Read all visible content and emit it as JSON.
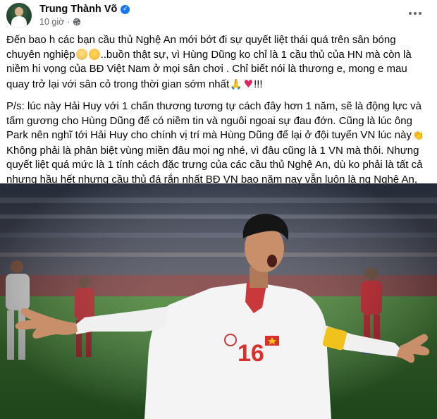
{
  "post": {
    "author": "Trung Thành Võ",
    "time": "10 giờ",
    "paragraph1": {
      "text1": "Đến bao h các bạn cầu thủ Nghệ An mới bớt đi sự quyết liệt thái quá trên sân bóng chuyên nghiệp",
      "text2": "..buồn thật sự, vì Hùng Dũng ko chỉ là 1 cầu thủ của HN mà còn là niềm hi vọng của BĐ Việt Nam ở mọi sân chơi . Chỉ biết nói là thương e, mong e mau quay trở lại với sân cỏ trong thời gian sớm nhất",
      "text3": "!!!"
    },
    "paragraph2": {
      "text1": "P/s: lúc này Hải Huy với 1 chấn thương tương tự cách đây hơn 1 năm, sẽ là động lực và tấm gương cho Hùng Dũng để có niềm tin và nguôi ngoai sự đau đớn. Cũng là lúc ông Park nên nghĩ tới Hải Huy cho chính vị trí mà Hùng Dũng để lại ở đội tuyển VN lúc này",
      "text2": "Không phải là phân biệt vùng miền đâu mọi ng nhé, vì đâu cũng là 1 VN mà thôi. Nhưng quyết liệt quá mức là 1 tính cách đặc trưng của các cầu thủ Nghệ An, dù ko phải là tất cả nhưng hầu hết nhưng cầu thủ đá rắn nhất BĐ VN bao năm nay vẫn luôn là ng Nghệ An, mọi ng ai cũng có thể kiểm chứng điều tôi nói!!!"
    },
    "photo": {
      "jersey_number": "16"
    }
  },
  "colors": {
    "verified": "#1877f2",
    "meta": "#65676b",
    "jersey": "#f4f4f4",
    "jersey_number": "#d8312b",
    "pitch": "#3f7f35",
    "opponent_kit": "#c8202a"
  },
  "icons": {
    "verified": "verified-badge-icon",
    "privacy": "globe-icon",
    "more": "more-options-icon"
  }
}
